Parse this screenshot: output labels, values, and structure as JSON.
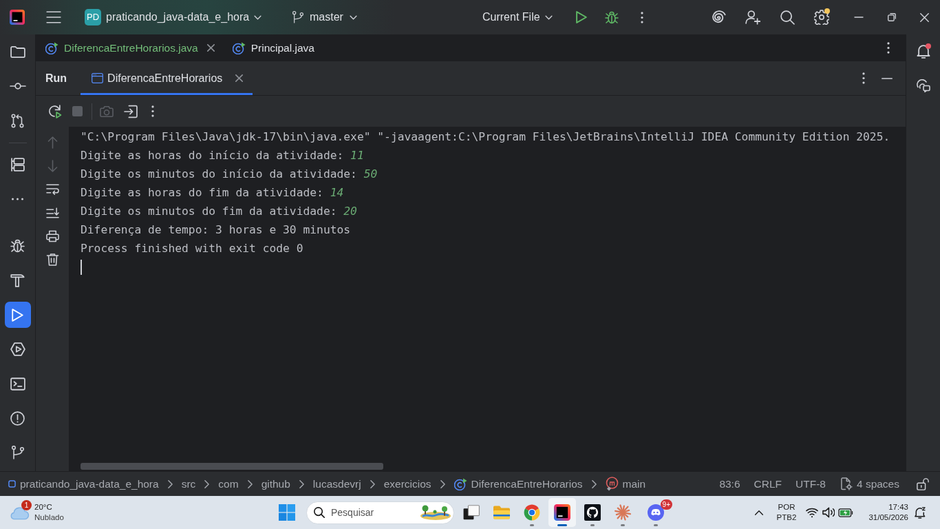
{
  "title_bar": {
    "project": {
      "badge": "PD",
      "name": "praticando_java-data_e_hora"
    },
    "branch": "master",
    "run_configuration": "Current File",
    "settings_update": true
  },
  "left_toolbar": {
    "top": [
      {
        "kind": "folder",
        "selected": false
      },
      {
        "kind": "commit",
        "selected": false
      },
      {
        "kind": "pullrequests",
        "selected": false
      }
    ],
    "middle": [
      {
        "kind": "structure",
        "selected": false
      },
      {
        "kind": "more",
        "selected": false
      }
    ],
    "bottom": [
      {
        "kind": "debug",
        "selected": false
      },
      {
        "kind": "build",
        "selected": false
      },
      {
        "kind": "run",
        "selected": true
      },
      {
        "kind": "services",
        "selected": false
      },
      {
        "kind": "terminal",
        "selected": false
      },
      {
        "kind": "problems",
        "selected": false
      },
      {
        "kind": "git",
        "selected": false
      }
    ]
  },
  "right_toolbar": [
    {
      "kind": "notifications",
      "unread": true
    },
    {
      "kind": "assistant",
      "unread": false
    }
  ],
  "editor_tabs": [
    {
      "label": "DiferencaEntreHorarios.java",
      "selected": true,
      "color": "#73bd79"
    },
    {
      "label": "Principal.java",
      "selected": false,
      "color": "#dfe1e5"
    }
  ],
  "run_panel": {
    "title": "Run",
    "tabs": [
      {
        "label": "DiferencaEntreHorarios",
        "selected": true
      }
    ],
    "toolbar": [
      {
        "kind": "rerun",
        "disabled": false
      },
      {
        "kind": "stop",
        "disabled": true
      },
      {
        "kind": "screenshot",
        "disabled": true
      },
      {
        "kind": "attach",
        "disabled": false
      },
      {
        "kind": "more",
        "disabled": false
      }
    ],
    "gutter": [
      {
        "kind": "up",
        "disabled": true
      },
      {
        "kind": "down",
        "disabled": true
      },
      {
        "kind": "softwrap",
        "disabled": false
      },
      {
        "kind": "scrollend",
        "disabled": false
      },
      {
        "kind": "print",
        "disabled": false
      },
      {
        "kind": "clear",
        "disabled": false
      }
    ],
    "console": {
      "lines": [
        {
          "text": "\"C:\\Program Files\\Java\\jdk-17\\bin\\java.exe\" \"-javaagent:C:\\Program Files\\JetBrains\\IntelliJ IDEA Community Edition 2025."
        },
        {
          "text": "Digite as horas do início da atividade:",
          "input": "11"
        },
        {
          "text": "Digite os minutos do início da atividade:",
          "input": "50"
        },
        {
          "text": "Digite as horas do fim da atividade:",
          "input": "14"
        },
        {
          "text": "Digite os minutos do fim da atividade:",
          "input": "20"
        },
        {
          "text": "Diferença de tempo: 3 horas e 30 minutos"
        },
        {
          "text": "Process finished with exit code 0"
        }
      ],
      "caret": true
    }
  },
  "status_bar": {
    "breadcrumbs": [
      {
        "kind": "module",
        "label": "praticando_java-data_e_hora"
      },
      {
        "kind": "package",
        "label": "src"
      },
      {
        "kind": "package",
        "label": "com"
      },
      {
        "kind": "package",
        "label": "github"
      },
      {
        "kind": "package",
        "label": "lucasdevrj"
      },
      {
        "kind": "package",
        "label": "exercicios"
      },
      {
        "kind": "class",
        "label": "DiferencaEntreHorarios"
      },
      {
        "kind": "method",
        "label": "main"
      }
    ],
    "position": "83:6",
    "line_separator": "CRLF",
    "encoding": "UTF-8",
    "indent": "4 spaces",
    "locked": false
  },
  "taskbar": {
    "weather": {
      "badge": "1",
      "temperature": "20°C",
      "condition": "Nublado"
    },
    "search": {
      "placeholder": "Pesquisar"
    },
    "apps": [
      {
        "kind": "taskview",
        "running": false,
        "selected": false
      },
      {
        "kind": "folder",
        "running": false,
        "selected": false
      },
      {
        "kind": "browser",
        "running": true,
        "selected": false
      },
      {
        "kind": "ide",
        "running": true,
        "selected": true
      },
      {
        "kind": "octocat",
        "running": true,
        "selected": false
      },
      {
        "kind": "sparkle",
        "running": true,
        "selected": false
      },
      {
        "kind": "chat",
        "running": true,
        "selected": false,
        "badge": "9+"
      }
    ],
    "tray": {
      "language": "POR",
      "layout": "PTB2",
      "time": "17:43",
      "date": "31/05/2026"
    }
  }
}
